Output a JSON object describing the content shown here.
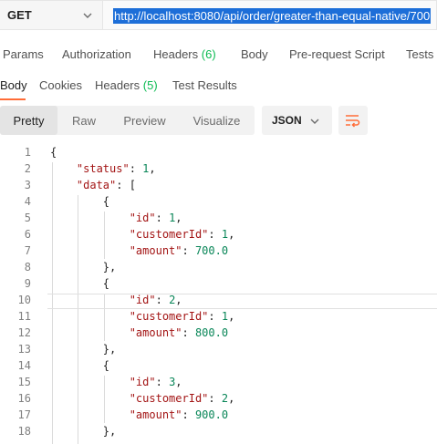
{
  "request": {
    "method": "GET",
    "url": "http://localhost:8080/api/order/greater-than-equal-native/700"
  },
  "request_tabs": [
    {
      "label": "Params",
      "count": ""
    },
    {
      "label": "Authorization",
      "count": ""
    },
    {
      "label": "Headers",
      "count": "(6)"
    },
    {
      "label": "Body",
      "count": ""
    },
    {
      "label": "Pre-request Script",
      "count": ""
    },
    {
      "label": "Tests",
      "count": ""
    }
  ],
  "response_tabs": [
    {
      "label": "Body",
      "count": "",
      "active": true
    },
    {
      "label": "Cookies",
      "count": ""
    },
    {
      "label": "Headers",
      "count": "(5)"
    },
    {
      "label": "Test Results",
      "count": ""
    }
  ],
  "toolbar": {
    "view_modes": [
      "Pretty",
      "Raw",
      "Preview",
      "Visualize"
    ],
    "active_view": "Pretty",
    "format": "JSON",
    "icons": [
      "chevron-down-icon",
      "wrap-lines-icon"
    ]
  },
  "colors": {
    "accent": "#ff6c37",
    "count": "#0cbb52",
    "url_selection": "#1d6ed8",
    "json_key": "#a31515",
    "json_number": "#098658"
  },
  "body": {
    "lines": [
      {
        "n": "1",
        "text": "{"
      },
      {
        "n": "2",
        "text": "    \"status\": 1,"
      },
      {
        "n": "3",
        "text": "    \"data\": ["
      },
      {
        "n": "4",
        "text": "        {"
      },
      {
        "n": "5",
        "text": "            \"id\": 1,"
      },
      {
        "n": "6",
        "text": "            \"customerId\": 1,"
      },
      {
        "n": "7",
        "text": "            \"amount\": 700.0"
      },
      {
        "n": "8",
        "text": "        },"
      },
      {
        "n": "9",
        "text": "        {"
      },
      {
        "n": "10",
        "text": "            \"id\": 2,"
      },
      {
        "n": "11",
        "text": "            \"customerId\": 1,"
      },
      {
        "n": "12",
        "text": "            \"amount\": 800.0"
      },
      {
        "n": "13",
        "text": "        },"
      },
      {
        "n": "14",
        "text": "        {"
      },
      {
        "n": "15",
        "text": "            \"id\": 3,"
      },
      {
        "n": "16",
        "text": "            \"customerId\": 2,"
      },
      {
        "n": "17",
        "text": "            \"amount\": 900.0"
      },
      {
        "n": "18",
        "text": "        },"
      }
    ]
  }
}
